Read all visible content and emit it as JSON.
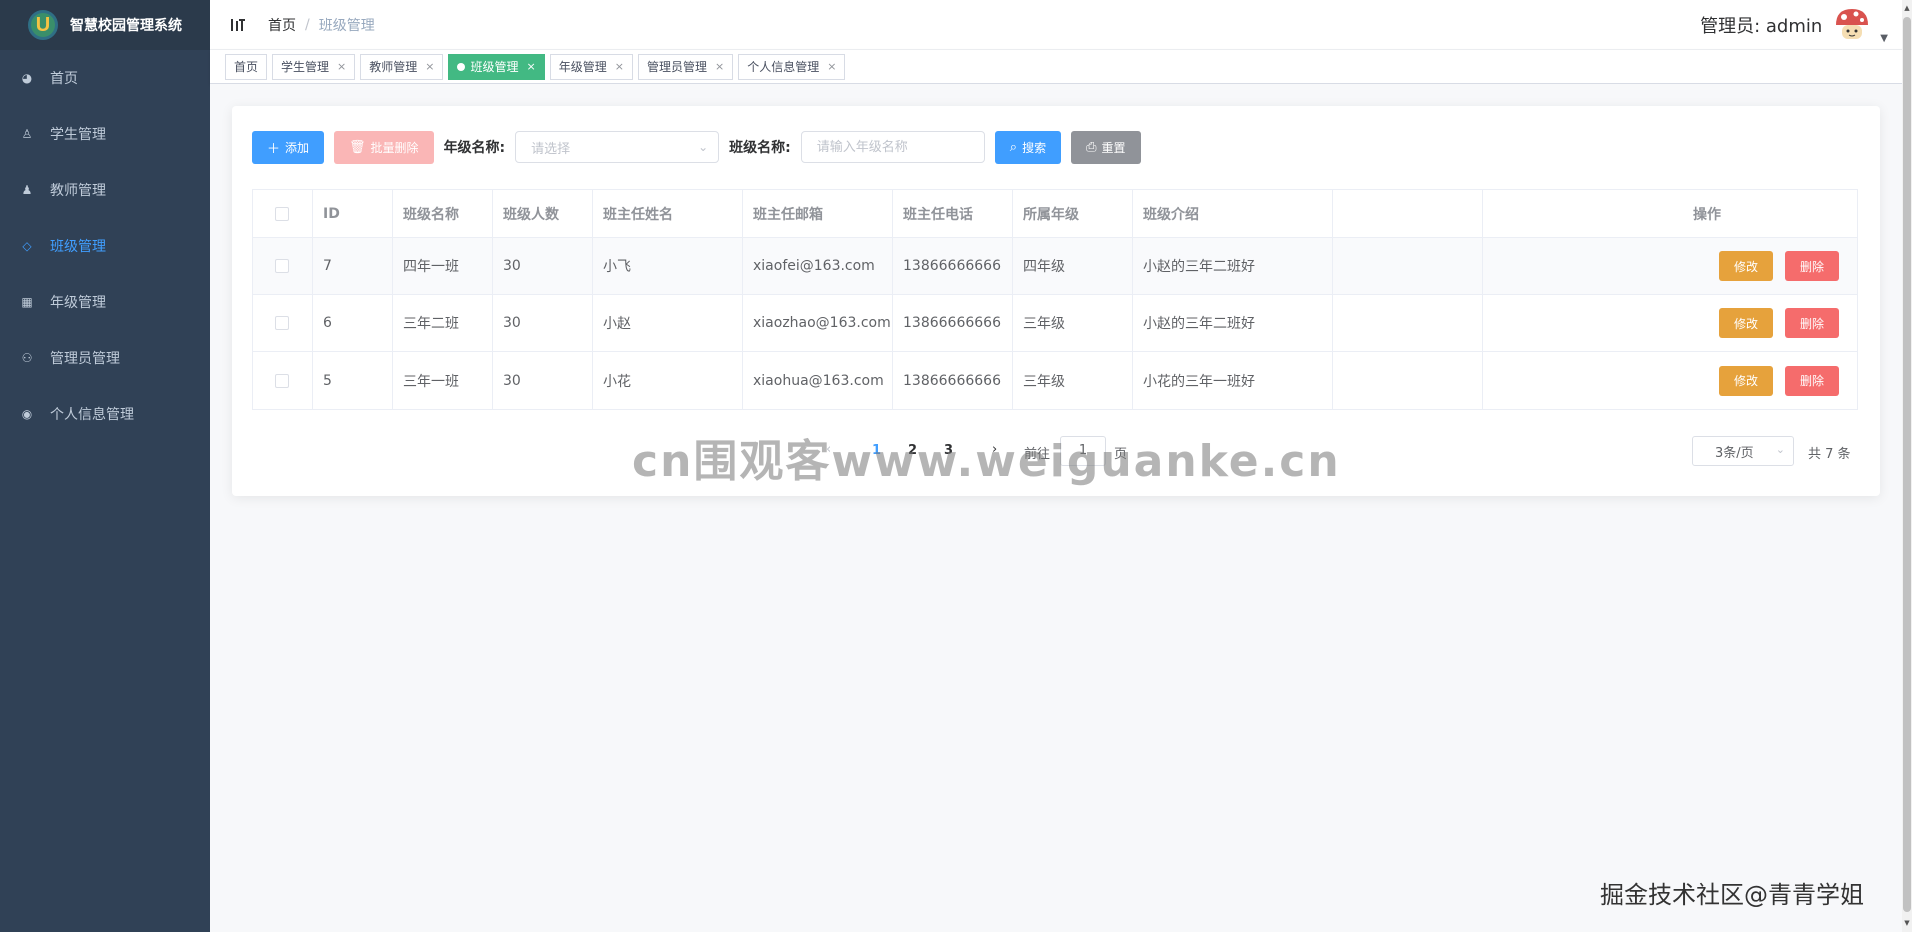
{
  "app": {
    "title": "智慧校园管理系统",
    "logo_letter": "U"
  },
  "sidebar": {
    "items": [
      {
        "label": "首页",
        "icon": "dashboard-icon",
        "active": false
      },
      {
        "label": "学生管理",
        "icon": "user-icon",
        "active": false
      },
      {
        "label": "教师管理",
        "icon": "teacher-icon",
        "active": false
      },
      {
        "label": "班级管理",
        "icon": "tag-icon",
        "active": true
      },
      {
        "label": "年级管理",
        "icon": "calendar-icon",
        "active": false
      },
      {
        "label": "管理员管理",
        "icon": "admin-icon",
        "active": false
      },
      {
        "label": "个人信息管理",
        "icon": "profile-icon",
        "active": false
      }
    ]
  },
  "header": {
    "breadcrumb_home": "首页",
    "breadcrumb_sep": "/",
    "breadcrumb_current": "班级管理",
    "user_label": "管理员: admin"
  },
  "tags": [
    {
      "label": "首页",
      "closable": false,
      "active": false
    },
    {
      "label": "学生管理",
      "closable": true,
      "active": false
    },
    {
      "label": "教师管理",
      "closable": true,
      "active": false
    },
    {
      "label": "班级管理",
      "closable": true,
      "active": true
    },
    {
      "label": "年级管理",
      "closable": true,
      "active": false
    },
    {
      "label": "管理员管理",
      "closable": true,
      "active": false
    },
    {
      "label": "个人信息管理",
      "closable": true,
      "active": false
    }
  ],
  "toolbar": {
    "add_label": "添加",
    "batch_delete_label": "批量删除",
    "grade_label": "年级名称:",
    "grade_placeholder": "请选择",
    "class_label": "班级名称:",
    "class_placeholder": "请输入年级名称",
    "search_label": "搜索",
    "reset_label": "重置"
  },
  "table": {
    "columns": [
      "ID",
      "班级名称",
      "班级人数",
      "班主任姓名",
      "班主任邮箱",
      "班主任电话",
      "所属年级",
      "班级介绍",
      "",
      "操作"
    ],
    "rows": [
      {
        "id": "7",
        "name": "四年一班",
        "count": "30",
        "teacher": "小飞",
        "email": "xiaofei@163.com",
        "phone": "13866666666",
        "grade": "四年级",
        "intro": "小赵的三年二班好"
      },
      {
        "id": "6",
        "name": "三年二班",
        "count": "30",
        "teacher": "小赵",
        "email": "xiaozhao@163.com",
        "phone": "13866666666",
        "grade": "三年级",
        "intro": "小赵的三年二班好"
      },
      {
        "id": "5",
        "name": "三年一班",
        "count": "30",
        "teacher": "小花",
        "email": "xiaohua@163.com",
        "phone": "13866666666",
        "grade": "三年级",
        "intro": "小花的三年一班好"
      }
    ],
    "edit_label": "修改",
    "delete_label": "删除"
  },
  "pagination": {
    "prev": "‹",
    "pages": [
      "1",
      "2",
      "3"
    ],
    "current": "1",
    "next": "›",
    "goto_label": "前往",
    "goto_value": "1",
    "goto_unit": "页",
    "page_size": "3条/页",
    "total": "共 7 条"
  },
  "watermarks": {
    "center": "cn围观客www.weiguanke.cn",
    "corner": "掘金技术社区@青青学姐"
  },
  "colors": {
    "sidebar_bg": "#304156",
    "active_tag": "#42b983",
    "primary": "#409eff",
    "warning": "#e6a23c",
    "danger": "#f56c6c"
  }
}
